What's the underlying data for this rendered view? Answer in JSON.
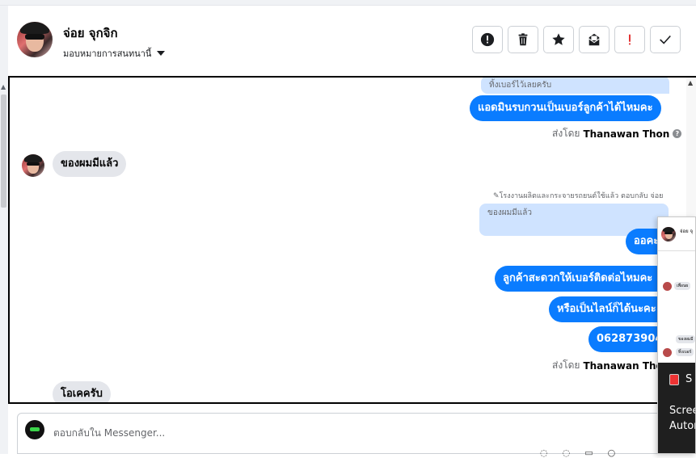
{
  "header": {
    "contact_name": "จ่อย จุกจิก",
    "assign_label": "มอบหมายการสนทนานี้"
  },
  "actions": [
    {
      "name": "report-spam-button",
      "icon": "exclamation-circle-icon"
    },
    {
      "name": "delete-button",
      "icon": "trash-icon"
    },
    {
      "name": "star-button",
      "icon": "star-icon"
    },
    {
      "name": "mark-unread-button",
      "icon": "mail-icon"
    },
    {
      "name": "mark-important-button",
      "icon": "exclamation-icon",
      "color": "#e02020"
    },
    {
      "name": "mark-done-button",
      "icon": "check-icon"
    }
  ],
  "messages": {
    "top_quote": "ทิ้งเบอร์ไว้เลยครับ",
    "msg1": "แอดมินรบกวนเป็นเบอร์ลูกค้าได้ไหมคะ",
    "sent_by_prefix": "ส่งโดย",
    "sender": "Thanawan Thon",
    "in1": "ของผมมีแล้ว",
    "reply_note": "✎โรงงานผลิตและกระจายรถยนต์ใช้แล้ว ตอบกลับ จ่อย",
    "quote2": "ของผมมีแล้ว",
    "msg2": "ออคะ",
    "msg3": "ลูกค้าสะดวกให้เบอร์ติดต่อไหมคะ",
    "msg4": "หรือเป็นไลน์ก็ได้นะคะ",
    "msg5": "0628739048",
    "in2": "โอเคครับ"
  },
  "composer": {
    "placeholder": "ตอบกลับใน Messenger..."
  },
  "popup": {
    "name": "จ่อย จุ",
    "mini1": "เพื่อนผ",
    "mini2": "ของผมมี",
    "mini3": "ทิ้งเบอร์",
    "dark_title": "S",
    "dark_line1": "Scree",
    "dark_line2": "Autor"
  },
  "colors": {
    "accent_blue": "#0a7cff",
    "incoming_gray": "#e4e6eb",
    "quote_blue": "#cfe3ff"
  }
}
